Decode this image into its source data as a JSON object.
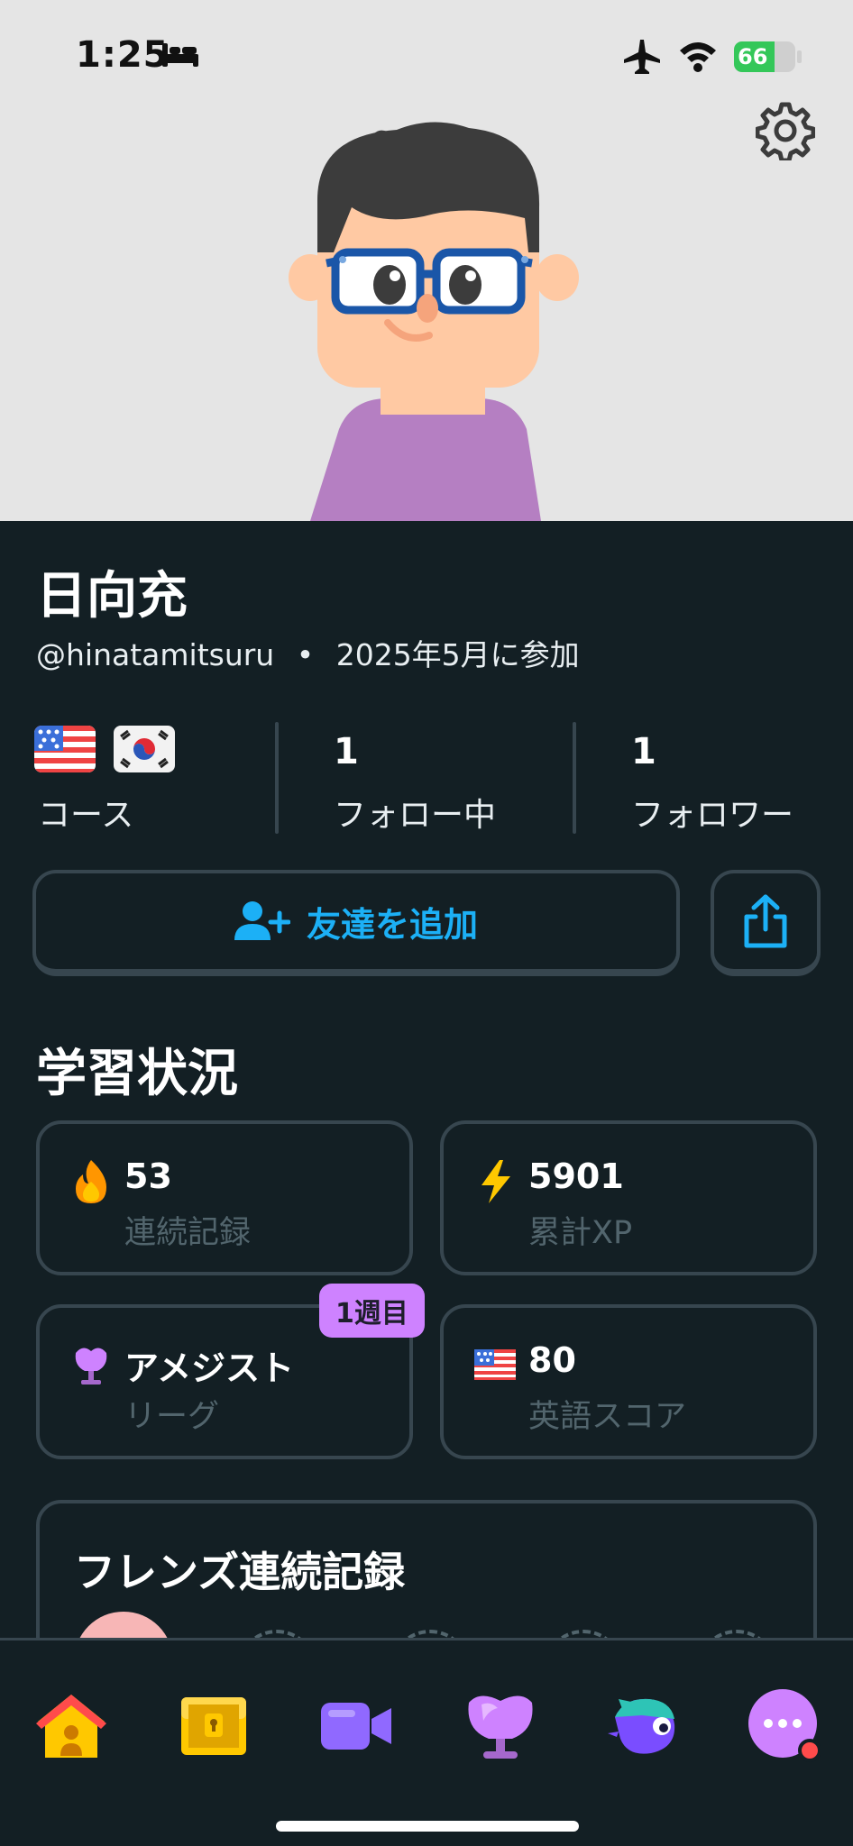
{
  "status_bar": {
    "time": "1:25",
    "battery": "66",
    "battery_level": 0.66
  },
  "profile": {
    "name": "日向充",
    "username": "@hinatamitsuru",
    "separator": "•",
    "joined": "2025年5月に参加"
  },
  "stats": {
    "courses_label": "コース",
    "following_count": "1",
    "following_label": "フォロー中",
    "followers_count": "1",
    "followers_label": "フォロワー"
  },
  "actions": {
    "add_friend_label": "友達を追加"
  },
  "progress": {
    "title": "学習状況",
    "streak": {
      "value": "53",
      "label": "連続記録"
    },
    "xp": {
      "value": "5901",
      "label": "累計XP"
    },
    "league": {
      "value": "アメジスト",
      "label": "リーグ",
      "badge": "1週目"
    },
    "score": {
      "value": "80",
      "label": "英語スコア"
    }
  },
  "friends_streak": {
    "title": "フレンズ連続記録"
  },
  "colors": {
    "background": "#131f24",
    "border": "#37464f",
    "accent_blue": "#1cb0f6",
    "muted_text": "#52656d",
    "amethyst": "#ce82ff"
  }
}
